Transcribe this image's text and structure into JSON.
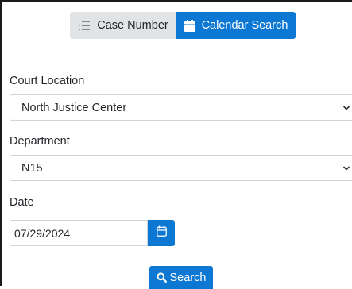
{
  "tabs": {
    "case_number": {
      "label": "Case Number",
      "icon": "list-icon"
    },
    "calendar_search": {
      "label": "Calendar Search",
      "icon": "calendar-icon",
      "active": true
    }
  },
  "form": {
    "court_location": {
      "label": "Court Location",
      "value": "North Justice Center"
    },
    "department": {
      "label": "Department",
      "value": "N15"
    },
    "date": {
      "label": "Date",
      "value": "07/29/2024"
    }
  },
  "search_button": {
    "label": "Search",
    "icon": "search-icon"
  },
  "colors": {
    "primary": "#0d78d4",
    "secondary_tab": "#e2e3e5",
    "input_border": "#ced4da"
  }
}
